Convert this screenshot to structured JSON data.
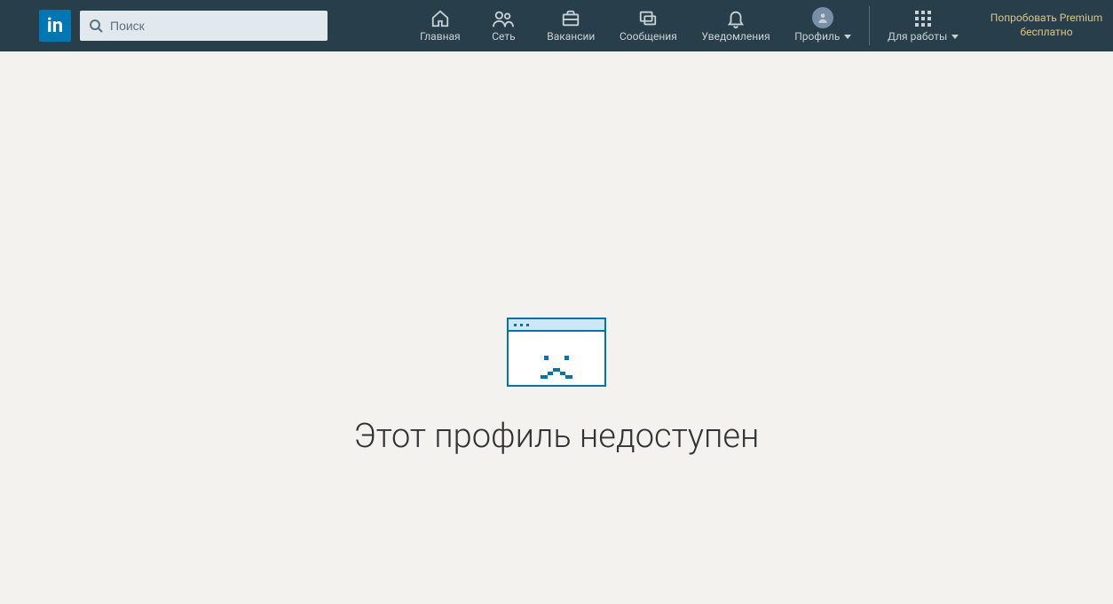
{
  "search": {
    "placeholder": "Поиск"
  },
  "nav": {
    "home": "Главная",
    "network": "Сеть",
    "jobs": "Вакансии",
    "messages": "Сообщения",
    "notifications": "Уведомления",
    "profile": "Профиль",
    "work": "Для работы"
  },
  "premium": {
    "cta": "Попробовать Premium бесплатно"
  },
  "error": {
    "title": "Этот профиль недоступен"
  }
}
